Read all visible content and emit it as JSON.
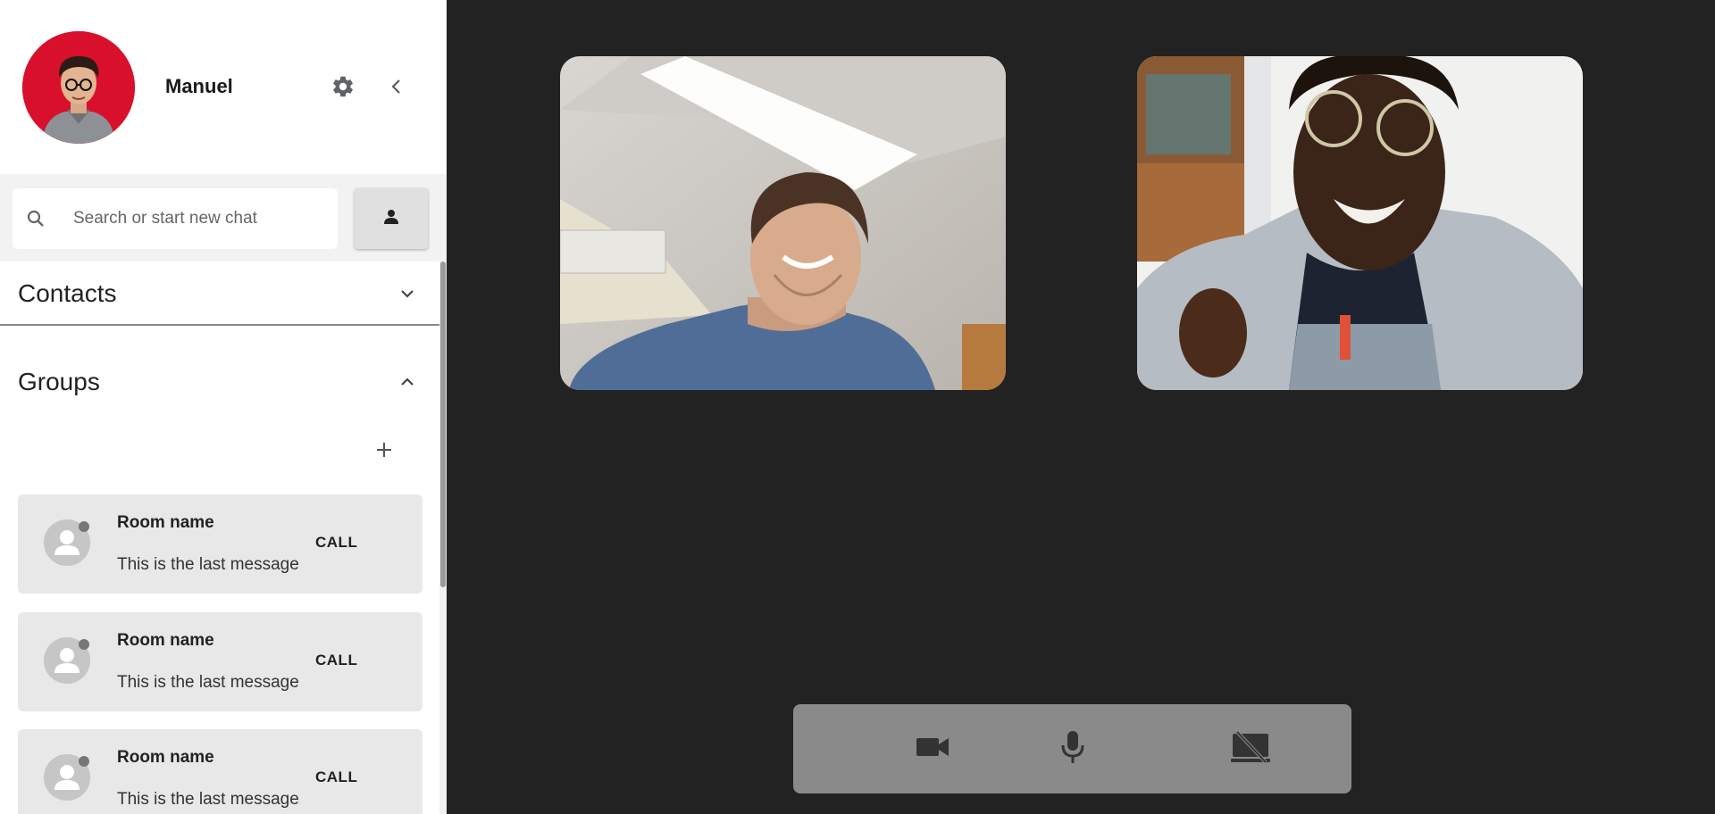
{
  "user": {
    "name": "Manuel"
  },
  "search": {
    "placeholder": "Search or start new chat"
  },
  "sections": {
    "contacts": "Contacts",
    "groups": "Groups"
  },
  "rooms": [
    {
      "name": "Room name",
      "last_message": "This is the last message",
      "call_label": "CALL"
    },
    {
      "name": "Room name",
      "last_message": "This is the last message",
      "call_label": "CALL"
    },
    {
      "name": "Room name",
      "last_message": "This is the last message",
      "call_label": "CALL"
    }
  ],
  "controls": [
    "camera-icon",
    "microphone-icon",
    "screen-share-off-icon"
  ],
  "colors": {
    "stage_background": "#222223",
    "avatar_background": "#d8102c",
    "control_bar": "#8a8a8a",
    "room_card": "#e8e8e8"
  }
}
